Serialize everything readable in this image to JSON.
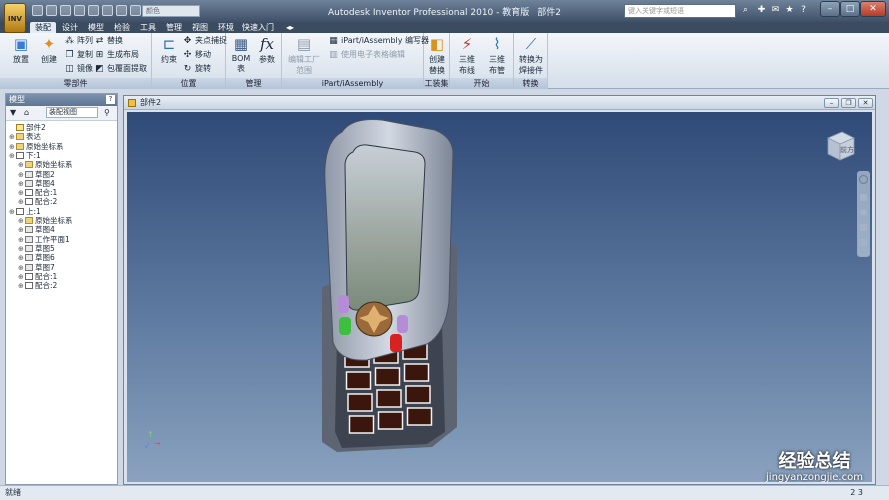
{
  "app": {
    "logo_text": "INV",
    "title": "Autodesk Inventor Professional 2010 - 教育版",
    "document": "部件2"
  },
  "quick_access": {
    "dropdown_value": "颜色"
  },
  "help_search": {
    "placeholder": "键入关键字或短语"
  },
  "tabs": [
    "装配",
    "设计",
    "模型",
    "检验",
    "工具",
    "管理",
    "视图",
    "环境",
    "快速入门"
  ],
  "ribbon": {
    "component": {
      "title": "零部件",
      "place": "放置",
      "create": "创建",
      "array": "阵列",
      "copy": "复制",
      "mirror": "镜像",
      "replace": "替换",
      "generate_layout": "生成布局",
      "shrinkwrap": "包覆面提取"
    },
    "position": {
      "title": "位置",
      "constrain": "约束",
      "grip_snap": "夹点捕捉",
      "move": "移动",
      "rotate": "旋转"
    },
    "manage": {
      "title": "管理",
      "bom": "BOM\n表",
      "params": "参数"
    },
    "ipart": {
      "title": "iPart/iAssembly",
      "edit_factory": "编辑工厂\n范围",
      "author": "iPart/iAssembly 编写器",
      "spreadsheet": "使用电子表格编辑"
    },
    "workspace": {
      "title": "工装集",
      "create_replace": "创建\n替换"
    },
    "begin": {
      "title": "开始",
      "route_3d": "三维\n布线",
      "tube_3d": "三维\n布管"
    },
    "convert": {
      "title": "转换",
      "to_weldment": "转换为\n焊接件"
    }
  },
  "browser": {
    "title": "模型",
    "view_dropdown": "装配视图",
    "tree": [
      {
        "label": "部件2",
        "level": 0,
        "icon": "p"
      },
      {
        "label": "表达",
        "level": 0,
        "icon": "f"
      },
      {
        "label": "原始坐标系",
        "level": 0,
        "icon": "f"
      },
      {
        "label": "下:1",
        "level": 0,
        "icon": "c"
      },
      {
        "label": "原始坐标系",
        "level": 1,
        "icon": "f"
      },
      {
        "label": "草图2",
        "level": 1,
        "icon": "w"
      },
      {
        "label": "草图4",
        "level": 1,
        "icon": "w"
      },
      {
        "label": "配合:1",
        "level": 1,
        "icon": "c"
      },
      {
        "label": "配合:2",
        "level": 1,
        "icon": "c"
      },
      {
        "label": "上:1",
        "level": 0,
        "icon": "c"
      },
      {
        "label": "原始坐标系",
        "level": 1,
        "icon": "f"
      },
      {
        "label": "草图4",
        "level": 1,
        "icon": "w"
      },
      {
        "label": "工作平面1",
        "level": 1,
        "icon": "w"
      },
      {
        "label": "草图5",
        "level": 1,
        "icon": "w"
      },
      {
        "label": "草图6",
        "level": 1,
        "icon": "w"
      },
      {
        "label": "草图7",
        "level": 1,
        "icon": "w"
      },
      {
        "label": "配合:1",
        "level": 1,
        "icon": "c"
      },
      {
        "label": "配合:2",
        "level": 1,
        "icon": "c"
      }
    ]
  },
  "document": {
    "title": "部件2"
  },
  "viewcube": {
    "label": "前方"
  },
  "status": {
    "text": "就绪",
    "right": "2  3"
  },
  "watermark": {
    "cn": "经验总结",
    "url": "jingyanzongjie.com"
  }
}
